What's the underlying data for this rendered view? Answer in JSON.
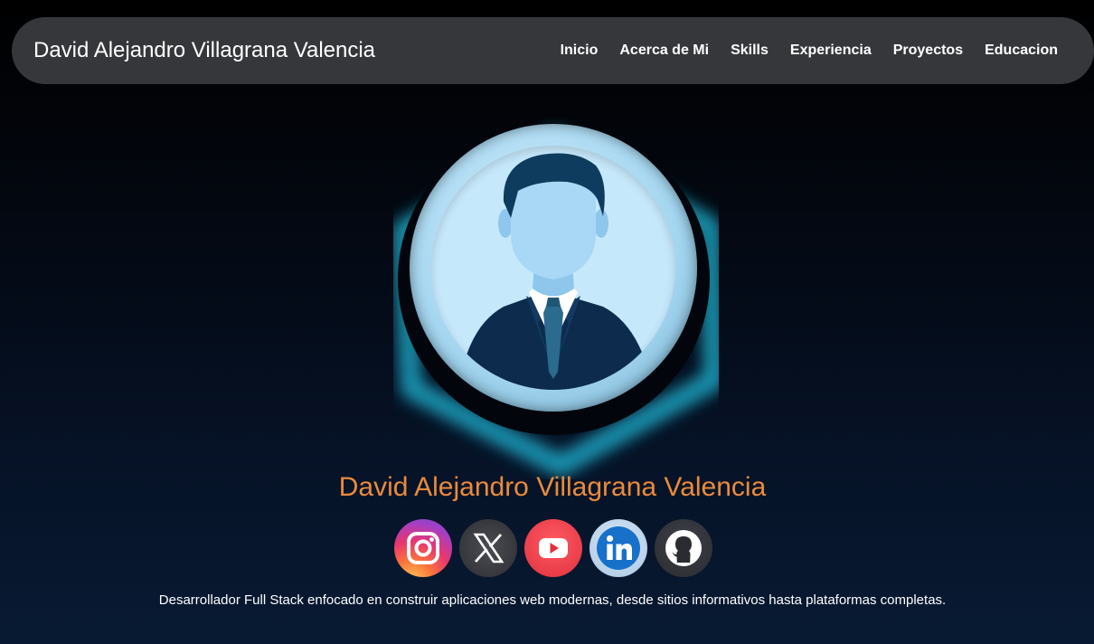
{
  "navbar": {
    "brand": "David Alejandro Villagrana Valencia",
    "links": [
      {
        "label": "Inicio"
      },
      {
        "label": "Acerca de Mi"
      },
      {
        "label": "Skills"
      },
      {
        "label": "Experiencia"
      },
      {
        "label": "Proyectos"
      },
      {
        "label": "Educacion"
      }
    ]
  },
  "hero": {
    "name": "David Alejandro Villagrana Valencia",
    "avatar_icon": "businessman-avatar-icon",
    "tagline": "Desarrollador Full Stack enfocado en construir aplicaciones web modernas, desde sitios informativos hasta plataformas completas."
  },
  "socials": [
    {
      "name": "instagram-icon"
    },
    {
      "name": "x-icon"
    },
    {
      "name": "youtube-icon"
    },
    {
      "name": "linkedin-icon"
    },
    {
      "name": "github-icon"
    }
  ],
  "colors": {
    "accent_name": "#ea8b3c",
    "navbar_bg": "#35373a",
    "glow": "#1fb6d6"
  }
}
